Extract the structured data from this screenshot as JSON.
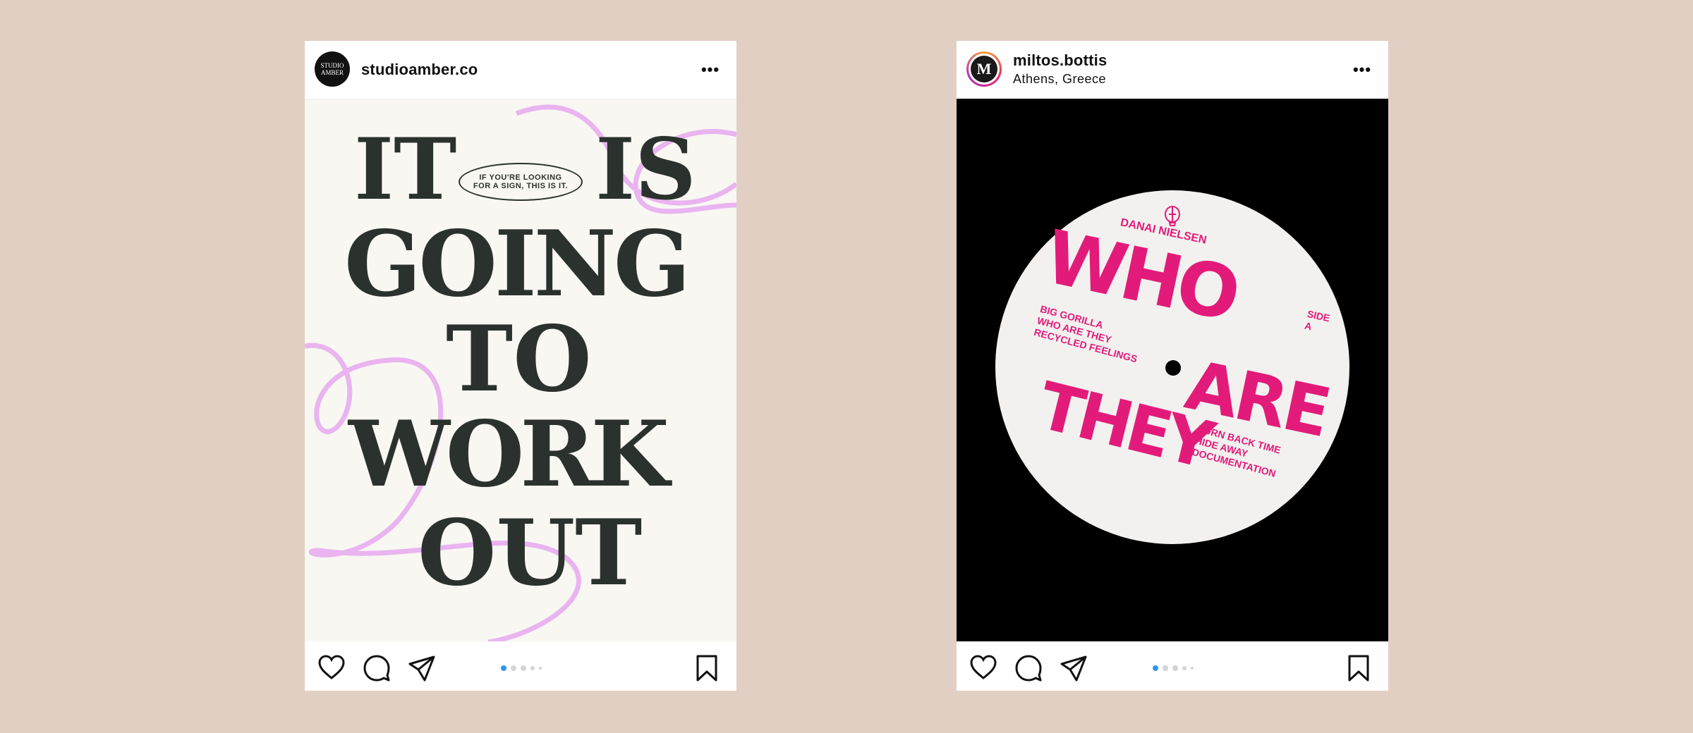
{
  "posts": [
    {
      "username": "studioamber.co",
      "avatar_text": "STUDIO\nAMBER",
      "more_label": "•••",
      "poster": {
        "line1_left": "IT",
        "line1_right": "IS",
        "sign_text": "IF YOU'RE LOOKING\nFOR A SIGN, THIS IS IT.",
        "line2": "GOING",
        "line3": "TO",
        "line4": "WORK",
        "line5": "OUT"
      },
      "carousel": {
        "count": 5,
        "active": 0
      }
    },
    {
      "username": "miltos.bottis",
      "location": "Athens, Greece",
      "avatar_text": "M",
      "more_label": "•••",
      "record": {
        "artist": "DANAI NIELSEN",
        "title_top": "WHO",
        "title_mid": "ARE",
        "title_bottom": "THEY",
        "side": "SIDE\nA",
        "tracks_a": [
          "BIG GORILLA",
          "WHO ARE THEY",
          "RECYCLED FEELINGS"
        ],
        "tracks_b": [
          "TURN BACK TIME",
          "HIDE AWAY",
          "DOCUMENTATION"
        ]
      },
      "carousel": {
        "count": 5,
        "active": 0
      }
    }
  ],
  "colors": {
    "background": "#e2cfc4",
    "poster_ink": "#2b322d",
    "poster_squiggle": "#e9b4f0",
    "record_ink": "#e21b7a",
    "carousel_active": "#2f96f0"
  },
  "icons": [
    "heart-icon",
    "comment-icon",
    "share-icon",
    "bookmark-icon",
    "more-icon"
  ]
}
